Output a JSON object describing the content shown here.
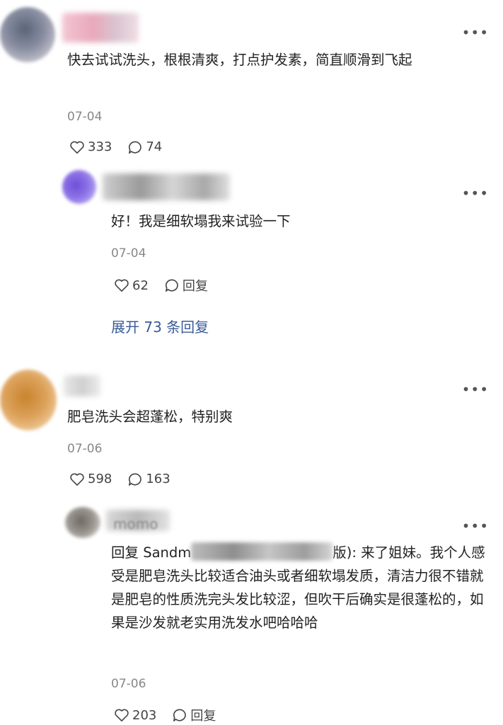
{
  "comments": [
    {
      "text": "快去试试洗头，根根清爽，打点护发素，简直顺滑到飞起",
      "date": "07-04",
      "likes": "333",
      "replies": "74",
      "sub": {
        "name_partial": "",
        "text": "好！我是细软塌我来试验一下",
        "date": "07-04",
        "likes": "62",
        "reply_label": "回复"
      },
      "expand_label": "展开 73 条回复"
    },
    {
      "text": "肥皂洗头会超蓬松，特别爽",
      "date": "07-06",
      "likes": "598",
      "replies": "163",
      "sub": {
        "name_partial": "momo",
        "reply_prefix": "回复 Sandm",
        "reply_suffix": "版): 来了姐妹。我个人感受是肥皂洗头比较适合油头或者细软塌发质，清洁力很不错就是肥皂的性质洗完头发比较涩，但吹干后确实是很蓬松的，如果是沙发就老实用洗发水吧哈哈哈",
        "date": "07-06",
        "likes": "203",
        "reply_label": "回复"
      }
    }
  ],
  "more_icon": "more-dots-icon",
  "heart_icon": "heart-icon",
  "bubble_icon": "comment-bubble-icon"
}
